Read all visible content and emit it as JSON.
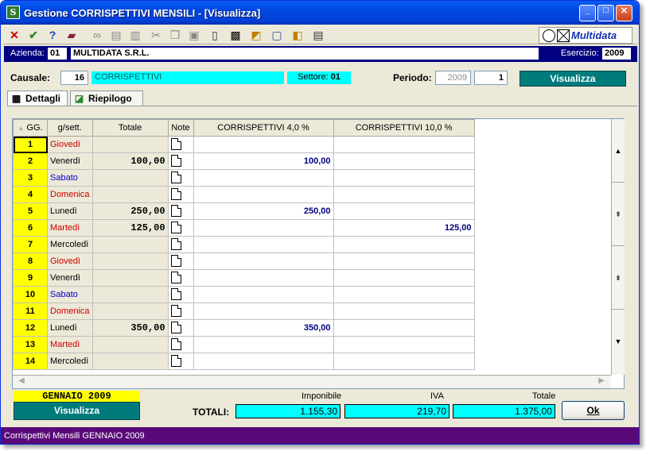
{
  "window": {
    "title": "Gestione CORRISPETTIVI MENSILI - [Visualizza]",
    "app_icon": "S"
  },
  "toolbar": {
    "icons": [
      "close-x-icon",
      "check-icon",
      "help-icon",
      "book-icon",
      "binoculars-icon",
      "print-icon",
      "print-preview-icon",
      "scissors-icon",
      "copy-icon",
      "paste-icon",
      "new-doc-icon",
      "filter-icon",
      "ruler-icon",
      "window-icon",
      "export-icon",
      "document-icon"
    ]
  },
  "logo": {
    "text": "Multidata"
  },
  "azienda": {
    "label": "Azienda:",
    "code": "01",
    "name": "MULTIDATA S.R.L.",
    "esercizio_label": "Esercizio:",
    "esercizio": "2009"
  },
  "form": {
    "causale_label": "Causale:",
    "causale_code": "16",
    "causale_desc": "CORRISPETTIVI",
    "settore_label": "Settore:",
    "settore": "01",
    "periodo_label": "Periodo:",
    "periodo_anno": "2009",
    "periodo_mese": "1",
    "visualizza": "Visualizza"
  },
  "tabs": [
    {
      "label": "Dettagli"
    },
    {
      "label": "Riepilogo"
    }
  ],
  "grid": {
    "columns": [
      "GG.",
      "g/sett.",
      "Totale",
      "Note",
      "CORRISPETTIVI  4,0 %",
      "CORRISPETTIVI 10,0 %"
    ],
    "rows": [
      {
        "gg": "1",
        "day": "Giovedì",
        "tot": "",
        "c4": "",
        "c10": ""
      },
      {
        "gg": "2",
        "day": "Venerdì",
        "tot": "100,00",
        "c4": "100,00",
        "c10": ""
      },
      {
        "gg": "3",
        "day": "Sabato",
        "tot": "",
        "c4": "",
        "c10": ""
      },
      {
        "gg": "4",
        "day": "Domenica",
        "tot": "",
        "c4": "",
        "c10": ""
      },
      {
        "gg": "5",
        "day": "Lunedì",
        "tot": "250,00",
        "c4": "250,00",
        "c10": ""
      },
      {
        "gg": "6",
        "day": "Martedì",
        "tot": "125,00",
        "c4": "",
        "c10": "125,00"
      },
      {
        "gg": "7",
        "day": "Mercoledì",
        "tot": "",
        "c4": "",
        "c10": ""
      },
      {
        "gg": "8",
        "day": "Giovedì",
        "tot": "",
        "c4": "",
        "c10": ""
      },
      {
        "gg": "9",
        "day": "Venerdì",
        "tot": "",
        "c4": "",
        "c10": ""
      },
      {
        "gg": "10",
        "day": "Sabato",
        "tot": "",
        "c4": "",
        "c10": ""
      },
      {
        "gg": "11",
        "day": "Domenica",
        "tot": "",
        "c4": "",
        "c10": ""
      },
      {
        "gg": "12",
        "day": "Lunedì",
        "tot": "350,00",
        "c4": "350,00",
        "c10": ""
      },
      {
        "gg": "13",
        "day": "Martedì",
        "tot": "",
        "c4": "",
        "c10": ""
      },
      {
        "gg": "14",
        "day": "Mercoledì",
        "tot": "",
        "c4": "",
        "c10": ""
      }
    ],
    "colors": {
      "Giovedì": "#cc0000",
      "Sabato": "#0000cc",
      "Domenica": "#cc0000",
      "Martedì": "#cc0000",
      "default": "#000000"
    }
  },
  "totals": {
    "month": "GENNAIO 2009",
    "visualizza": "Visualizza",
    "label": "TOTALI:",
    "imponibile_label": "Imponibile",
    "iva_label": "IVA",
    "totale_label": "Totale",
    "imponibile": "1.155,30",
    "iva": "219,70",
    "totale": "1.375,00",
    "ok": "Ok"
  },
  "status": "Corrispettivi Mensili GENNAIO 2009"
}
